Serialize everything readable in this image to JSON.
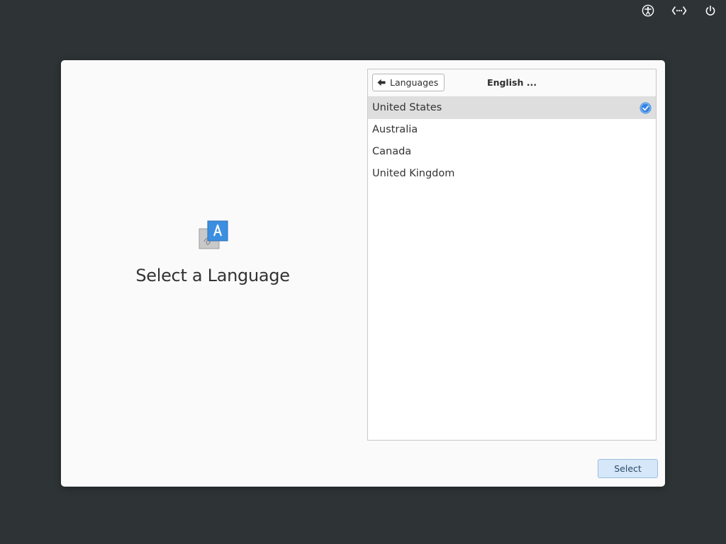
{
  "top_bar": {
    "icons": [
      "accessibility-icon",
      "keyboard-layout-icon",
      "power-icon"
    ]
  },
  "left_pane": {
    "icon": "language-icon",
    "title": "Select a Language"
  },
  "list_panel": {
    "back_label": "Languages",
    "header_title": "English ...",
    "items": [
      {
        "label": "United States",
        "selected": true
      },
      {
        "label": "Australia",
        "selected": false
      },
      {
        "label": "Canada",
        "selected": false
      },
      {
        "label": "United Kingdom",
        "selected": false
      }
    ]
  },
  "footer": {
    "select_label": "Select"
  },
  "colors": {
    "background": "#2e3436",
    "dialog": "#fafafa",
    "selected_row": "#dedede",
    "accent": "#3584e4",
    "select_button": "#d5e7f9"
  }
}
